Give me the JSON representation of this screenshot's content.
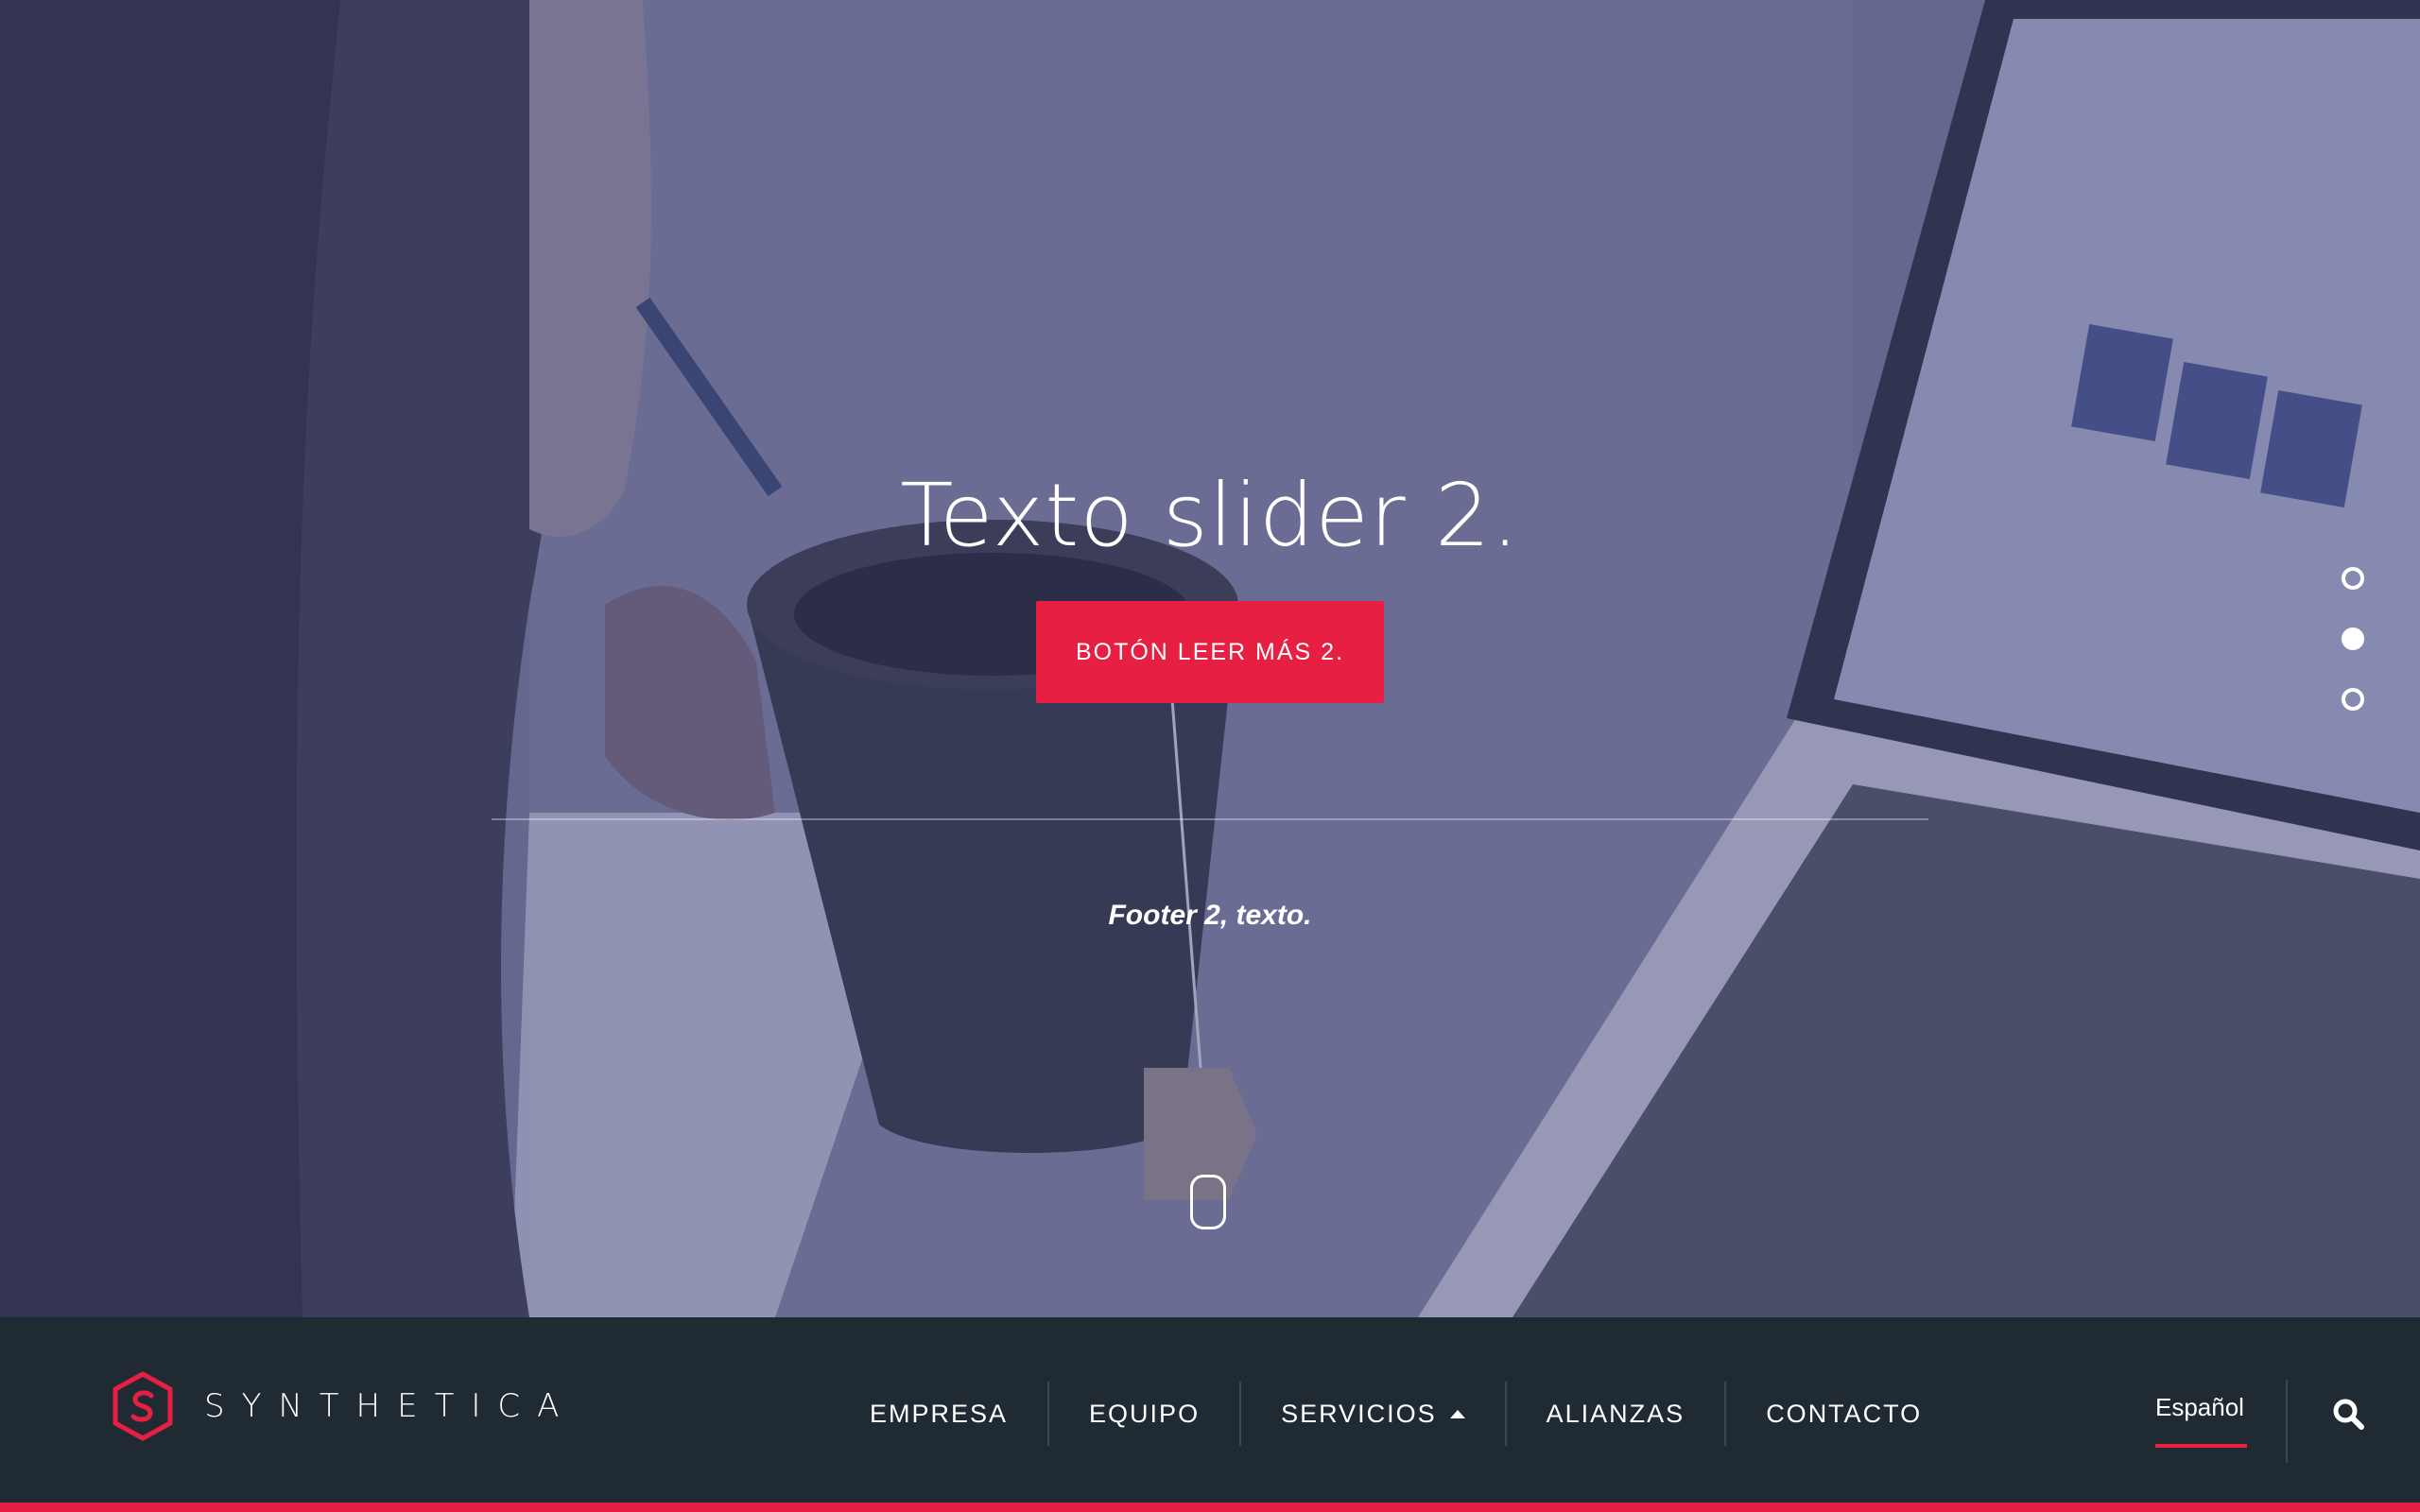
{
  "hero": {
    "title": "Texto slider 2.",
    "button_label": "BOTÓN LEER MÁS 2.",
    "footer_text": "Footer 2, texto.",
    "slides": {
      "count": 3,
      "active_index": 1
    }
  },
  "brand": {
    "name": "SYNTHETICA",
    "logo_icon": "hexagon-s-logo-icon"
  },
  "nav": {
    "items": [
      {
        "label": "EMPRESA"
      },
      {
        "label": "EQUIPO"
      },
      {
        "label": "SERVICIOS",
        "icon": "caret-up-icon"
      },
      {
        "label": "ALIANZAS"
      },
      {
        "label": "CONTACTO"
      }
    ],
    "language": "Español",
    "search_icon": "search-icon"
  },
  "colors": {
    "accent": "#e61f43",
    "navbar_bg": "#1f2a33",
    "text": "#ffffff"
  }
}
